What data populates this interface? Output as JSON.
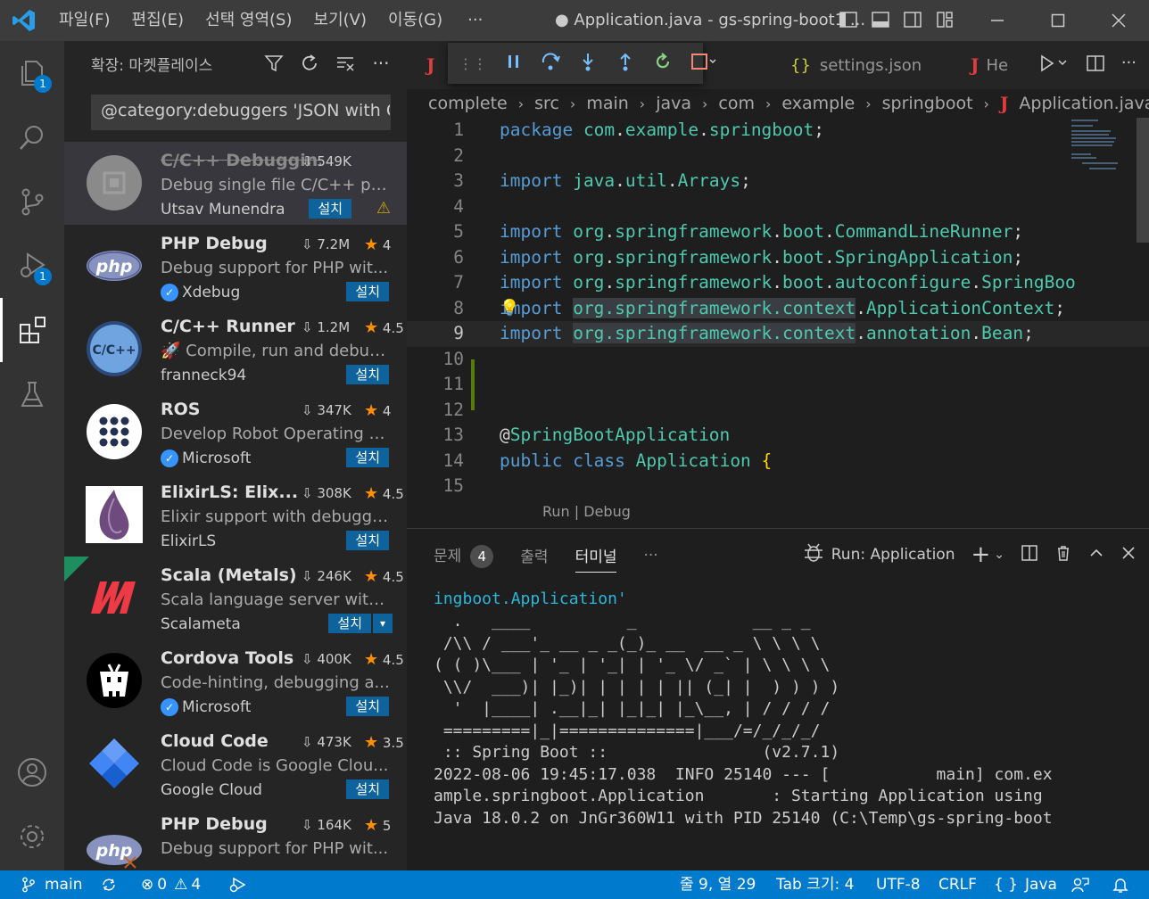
{
  "titlebar": {
    "menu": [
      "파일(F)",
      "편집(E)",
      "선택 영역(S)",
      "보기(V)",
      "이동(G)"
    ],
    "more": "···",
    "title": "● Application.java - gs-spring-boot1 ..."
  },
  "activity": {
    "explorer_badge": "1",
    "debug_badge": "1"
  },
  "sidebar": {
    "title": "확장: 마켓플레이스",
    "search_value": "@category:debuggers 'JSON with Co",
    "more": "···",
    "extensions": [
      {
        "name": "C/C++ Debuggin...",
        "downloads": "549K",
        "rating": "",
        "description": "Debug single file C/C++ pr...",
        "publisher": "Utsav Munendra",
        "verified": false,
        "install": "설치",
        "warning": true
      },
      {
        "name": "PHP Debug",
        "downloads": "7.2M",
        "rating": "4",
        "description": "Debug support for PHP wit...",
        "publisher": "Xdebug",
        "verified": true,
        "install": "설치"
      },
      {
        "name": "C/C++ Runner",
        "downloads": "1.2M",
        "rating": "4.5",
        "description": "🚀 Compile, run and debug...",
        "publisher": "franneck94",
        "verified": false,
        "install": "설치"
      },
      {
        "name": "ROS",
        "downloads": "347K",
        "rating": "4",
        "description": "Develop Robot Operating S...",
        "publisher": "Microsoft",
        "verified": true,
        "install": "설치"
      },
      {
        "name": "ElixirLS: Elix...",
        "downloads": "308K",
        "rating": "4.5",
        "description": "Elixir support with debugge...",
        "publisher": "ElixirLS",
        "verified": false,
        "install": "설치"
      },
      {
        "name": "Scala (Metals)",
        "downloads": "246K",
        "rating": "4.5",
        "description": "Scala language server with r...",
        "publisher": "Scalameta",
        "verified": false,
        "install": "설치",
        "split": true
      },
      {
        "name": "Cordova Tools",
        "downloads": "400K",
        "rating": "4.5",
        "description": "Code-hinting, debugging a...",
        "publisher": "Microsoft",
        "verified": true,
        "install": "설치"
      },
      {
        "name": "Cloud Code",
        "downloads": "473K",
        "rating": "3.5",
        "description": "Cloud Code is Google Clou...",
        "publisher": "Google Cloud",
        "verified": false,
        "install": "설치"
      },
      {
        "name": "PHP Debug",
        "downloads": "164K",
        "rating": "5",
        "description": "Debug support for PHP wit...",
        "publisher": "",
        "verified": false,
        "install": "설치"
      }
    ],
    "icon_labels": {
      "php": "php",
      "cpp": "C/C++"
    }
  },
  "editor": {
    "tab_settings": "settings.json",
    "tab_partial": "He",
    "breadcrumb": [
      "complete",
      "src",
      "main",
      "java",
      "com",
      "example",
      "springboot",
      "Application.java",
      "..."
    ],
    "codelens": "Run | Debug",
    "line_numbers": [
      "1",
      "2",
      "3",
      "4",
      "5",
      "6",
      "7",
      "8",
      "9",
      "10",
      "11",
      "12",
      "13",
      "14",
      "15"
    ]
  },
  "panel": {
    "tabs": {
      "problems": "문제",
      "problems_count": "4",
      "output": "출력",
      "terminal": "터미널",
      "more": "···"
    },
    "run_label": "Run: Application",
    "terminal_first": "ingboot.Application'",
    "terminal_art": "  .   ____          _            __ _ _\n /\\\\ / ___'_ __ _ _(_)_ __  __ _ \\ \\ \\ \\\n( ( )\\___ | '_ | '_| | '_ \\/ _` | \\ \\ \\ \\\n \\\\/  ___)| |_)| | | | | || (_| |  ) ) ) )\n  '  |____| .__|_| |_|_| |_\\__, | / / / /\n =========|_|==============|___/=/_/_/_/\n :: Spring Boot ::                (v2.7.1)",
    "terminal_log": "2022-08-06 19:45:17.038  INFO 25140 --- [           main] com.ex\nample.springboot.Application       : Starting Application using\nJava 18.0.2 on JnGr360W11 with PID 25140 (C:\\Temp\\gs-spring-boot"
  },
  "statusbar": {
    "branch": "main",
    "errors": "0",
    "warnings": "4",
    "position": "줄 9, 열 29",
    "tab_size": "Tab 크기: 4",
    "encoding": "UTF-8",
    "eol": "CRLF",
    "language": "Java"
  },
  "colors": {
    "accent": "#007acc",
    "install": "#0e639c",
    "star": "#ff8e00"
  }
}
